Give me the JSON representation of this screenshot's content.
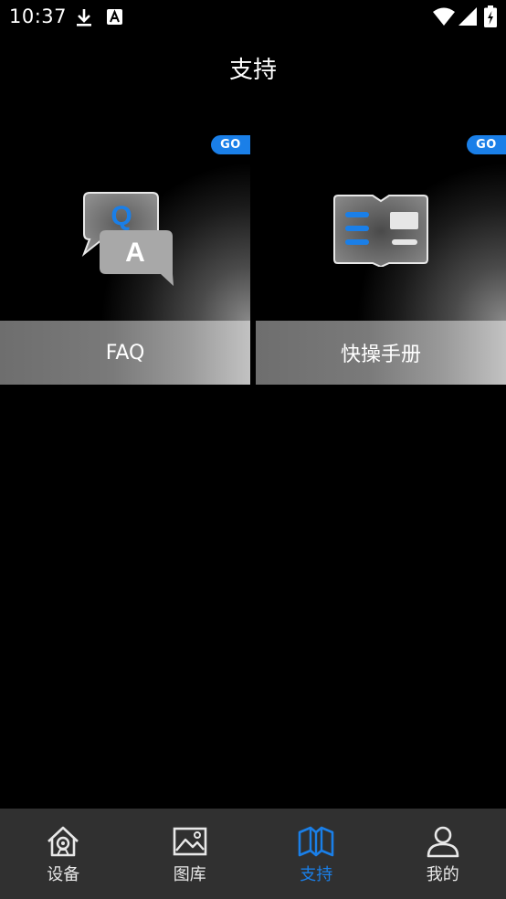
{
  "status_bar": {
    "time": "10:37",
    "icons": [
      "download-icon",
      "a-notification-icon",
      "wifi-icon",
      "signal-icon",
      "battery-icon"
    ]
  },
  "header": {
    "title": "支持"
  },
  "cards": [
    {
      "label": "FAQ",
      "badge": "GO",
      "icon": "qa-chat-icon"
    },
    {
      "label": "快操手册",
      "badge": "GO",
      "icon": "manual-book-icon"
    }
  ],
  "bottom_nav": {
    "items": [
      {
        "label": "设备",
        "icon": "home-device-icon",
        "active": false
      },
      {
        "label": "图库",
        "icon": "gallery-icon",
        "active": false
      },
      {
        "label": "支持",
        "icon": "book-support-icon",
        "active": true
      },
      {
        "label": "我的",
        "icon": "user-icon",
        "active": false
      }
    ]
  },
  "colors": {
    "background": "#000000",
    "accent": "#1a7fe8",
    "nav_background": "#303030"
  }
}
